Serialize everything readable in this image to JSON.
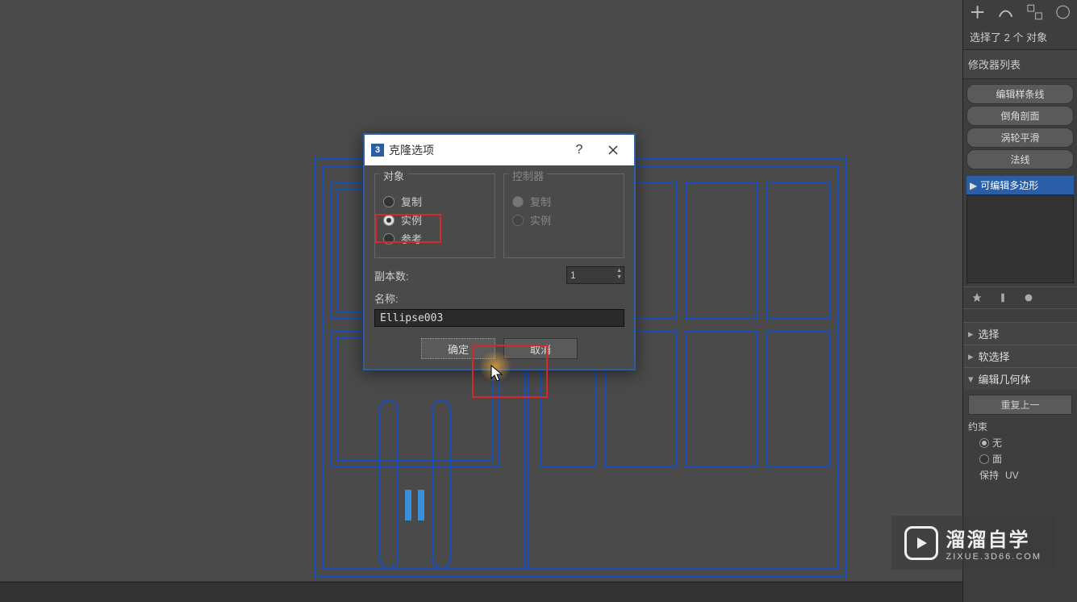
{
  "dialog": {
    "title": "克隆选项",
    "group_object": "对象",
    "group_controller": "控制器",
    "opt_copy": "复制",
    "opt_instance": "实例",
    "opt_reference": "参考",
    "copies_label": "副本数:",
    "copies_value": "1",
    "name_label": "名称:",
    "name_value": "Ellipse003",
    "ok": "确定",
    "cancel": "取消"
  },
  "panel": {
    "selection_info": "选择了 2 个 对象",
    "modifier_list": "修改器列表",
    "btn_edit_spline": "编辑样条线",
    "btn_chamfer": "倒角剖面",
    "btn_turbosmooth": "涡轮平滑",
    "btn_normal": "法线",
    "stack_item": "可编辑多边形",
    "rollout_select": "选择",
    "rollout_softselect": "软选择",
    "rollout_editgeo": "编辑几何体",
    "repeat_last": "重复上一",
    "constraints": "约束",
    "constraint_none": "无",
    "constraint_face": "面",
    "constraint_preserve": "保持",
    "constraint_uv": "UV"
  },
  "watermark": {
    "main": "溜溜自学",
    "sub": "ZIXUE.3D66.COM"
  }
}
